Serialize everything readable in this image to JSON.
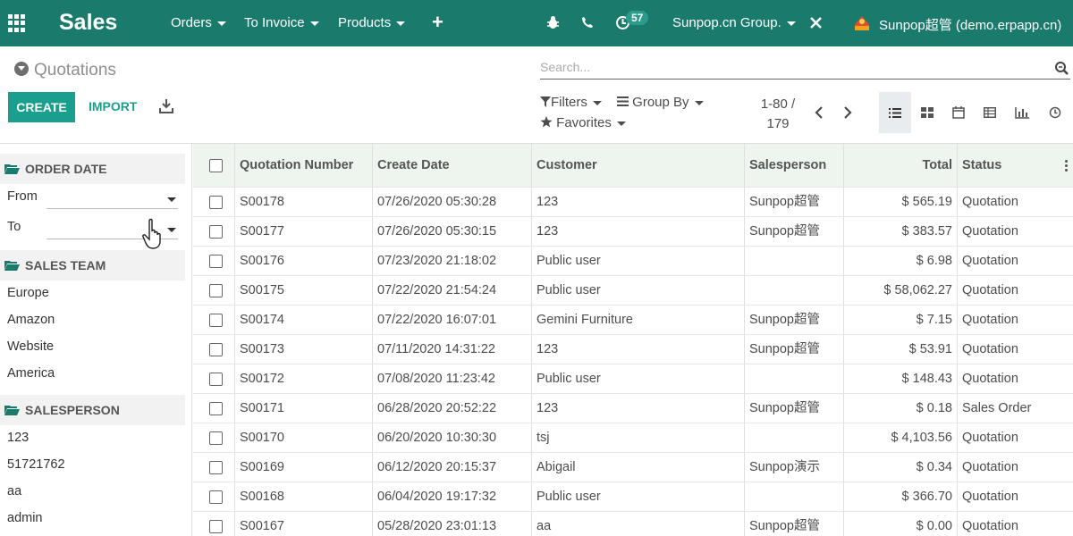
{
  "navbar": {
    "brand": "Sales",
    "menus": [
      "Orders",
      "To Invoice",
      "Products"
    ],
    "notifications_count": "57",
    "company": "Sunpop.cn Group.",
    "user": "Sunpop超管 (demo.erpapp.cn)"
  },
  "control": {
    "title": "Quotations",
    "create_label": "CREATE",
    "import_label": "IMPORT",
    "search_placeholder": "Search...",
    "filters_label": "Filters",
    "groupby_label": "Group By",
    "favorites_label": "Favorites",
    "pager_range": "1-80 /",
    "pager_total": "179",
    "views": [
      "list-view-icon",
      "kanban-view-icon",
      "calendar-view-icon",
      "pivot-view-icon",
      "graph-view-icon",
      "activity-view-icon"
    ]
  },
  "sidebar": {
    "order_date": {
      "title": "ORDER DATE",
      "from_label": "From",
      "to_label": "To"
    },
    "sales_team": {
      "title": "SALES TEAM",
      "items": [
        "Europe",
        "Amazon",
        "Website",
        "America"
      ]
    },
    "salesperson": {
      "title": "SALESPERSON",
      "items": [
        "123",
        "51721762",
        "aa",
        "admin"
      ]
    }
  },
  "table": {
    "columns": [
      "Quotation Number",
      "Create Date",
      "Customer",
      "Salesperson",
      "Total",
      "Status"
    ],
    "rows": [
      [
        "S00178",
        "07/26/2020 05:30:28",
        "123",
        "Sunpop超管",
        "$ 565.19",
        "Quotation"
      ],
      [
        "S00177",
        "07/26/2020 05:30:15",
        "123",
        "Sunpop超管",
        "$ 383.57",
        "Quotation"
      ],
      [
        "S00176",
        "07/23/2020 21:18:02",
        "Public user",
        "",
        "$ 6.98",
        "Quotation"
      ],
      [
        "S00175",
        "07/22/2020 21:54:24",
        "Public user",
        "",
        "$ 58,062.27",
        "Quotation"
      ],
      [
        "S00174",
        "07/22/2020 16:07:01",
        "Gemini Furniture",
        "Sunpop超管",
        "$ 7.15",
        "Quotation"
      ],
      [
        "S00173",
        "07/11/2020 14:31:22",
        "123",
        "Sunpop超管",
        "$ 53.91",
        "Quotation"
      ],
      [
        "S00172",
        "07/08/2020 11:23:42",
        "Public user",
        "",
        "$ 148.43",
        "Quotation"
      ],
      [
        "S00171",
        "06/28/2020 20:52:22",
        "123",
        "Sunpop超管",
        "$ 0.18",
        "Sales Order"
      ],
      [
        "S00170",
        "06/20/2020 10:30:30",
        "tsj",
        "",
        "$ 4,103.56",
        "Quotation"
      ],
      [
        "S00169",
        "06/12/2020 20:15:37",
        "Abigail",
        "Sunpop演示",
        "$ 0.34",
        "Quotation"
      ],
      [
        "S00168",
        "06/04/2020 19:17:32",
        "Public user",
        "",
        "$ 366.70",
        "Quotation"
      ],
      [
        "S00167",
        "05/28/2020 23:01:13",
        "aa",
        "Sunpop超管",
        "$ 0.00",
        "Quotation"
      ]
    ]
  },
  "colors": {
    "navbar": "#1a7a6b",
    "accent": "#1a9e8e"
  }
}
